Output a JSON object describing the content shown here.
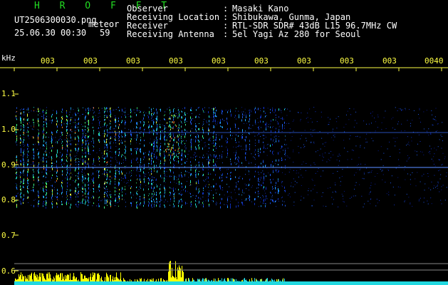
{
  "header": {
    "app_name": "H R O F F T",
    "file_name": "UT2506300030.png",
    "mode": "meteor",
    "datetime": "25.06.30 00:30",
    "count": "59",
    "fields": [
      {
        "label": "Observer",
        "value": "Masaki Kano"
      },
      {
        "label": "Receiving Location",
        "value": "Shibukawa, Gunma, Japan"
      },
      {
        "label": "Receiver",
        "value": "RTL-SDR SDR# 43dB L15 96.7MHz CW"
      },
      {
        "label": "Receiving Antenna",
        "value": "5el Yagi Az 280 for Seoul"
      }
    ]
  },
  "spectrogram": {
    "y_unit": "kHz",
    "y_ticks": [
      "1.1",
      "1.0",
      "0.9",
      "0.8",
      "0.7",
      "0.6"
    ],
    "x_ticks": [
      "003",
      "003",
      "003",
      "003",
      "003",
      "003",
      "003",
      "003",
      "003",
      "0040"
    ],
    "colors": {
      "axis": "#ffff44",
      "label_white": "#ffffff",
      "label_green": "#22dd22",
      "signal_line": "#3a6bff"
    }
  }
}
